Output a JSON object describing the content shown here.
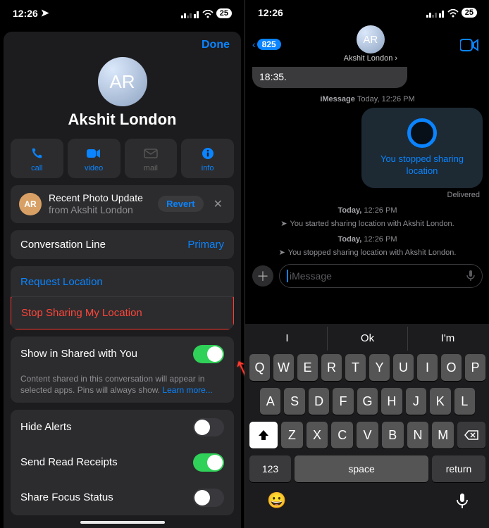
{
  "status": {
    "time": "12:26",
    "battery": "25"
  },
  "left": {
    "done": "Done",
    "avatar_initials": "AR",
    "contact_name": "Akshit London",
    "actions": [
      {
        "label": "call",
        "enabled": true
      },
      {
        "label": "video",
        "enabled": true
      },
      {
        "label": "mail",
        "enabled": false
      },
      {
        "label": "info",
        "enabled": true
      }
    ],
    "photo_update": {
      "avatar": "AR",
      "title": "Recent Photo Update",
      "subtitle": "from Akshit London",
      "revert": "Revert"
    },
    "conversation_line": {
      "label": "Conversation Line",
      "value": "Primary"
    },
    "request_location": "Request Location",
    "stop_sharing": "Stop Sharing My Location",
    "show_shared": {
      "label": "Show in Shared with You",
      "on": true
    },
    "shared_help": "Content shared in this conversation will appear in selected apps. Pins will always show.",
    "learn_more": "Learn more...",
    "hide_alerts": {
      "label": "Hide Alerts",
      "on": false
    },
    "read_receipts": {
      "label": "Send Read Receipts",
      "on": true
    },
    "focus_status": {
      "label": "Share Focus Status",
      "on": false
    }
  },
  "right": {
    "back_count": "825",
    "avatar_initials": "AR",
    "contact_name": "Akshit London",
    "stub_time": "18:35.",
    "imsg_label": "iMessage",
    "imsg_time": "Today, 12:26 PM",
    "bubble_text": "You stopped sharing location",
    "delivered": "Delivered",
    "sys1_time": "Today, 12:26 PM",
    "sys1_text": "You started sharing location with Akshit London.",
    "sys2_time": "Today, 12:26 PM",
    "sys2_text": "You stopped sharing location with Akshit London.",
    "compose_placeholder": "iMessage",
    "predictions": [
      "I",
      "Ok",
      "I'm"
    ],
    "keys_row1": [
      "Q",
      "W",
      "E",
      "R",
      "T",
      "Y",
      "U",
      "I",
      "O",
      "P"
    ],
    "keys_row2": [
      "A",
      "S",
      "D",
      "F",
      "G",
      "H",
      "J",
      "K",
      "L"
    ],
    "keys_row3": [
      "Z",
      "X",
      "C",
      "V",
      "B",
      "N",
      "M"
    ],
    "key_123": "123",
    "key_space": "space",
    "key_return": "return"
  }
}
